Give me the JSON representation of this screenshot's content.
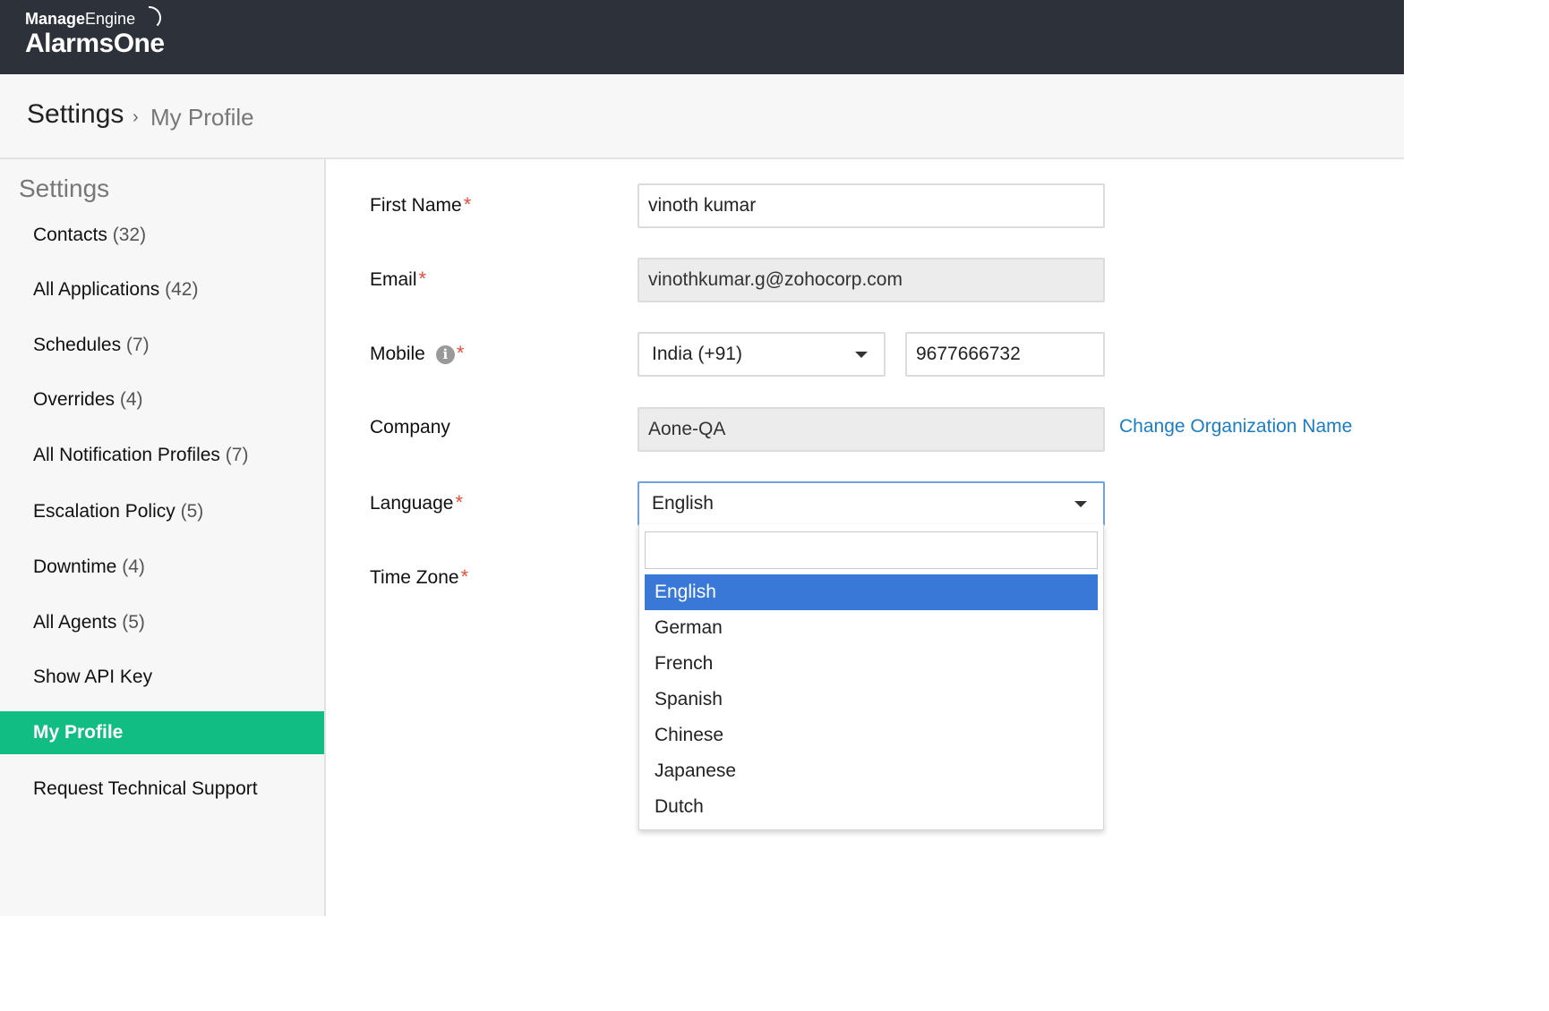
{
  "brand": {
    "company_bold": "Manage",
    "company_light": "Engine",
    "product": "AlarmsOne"
  },
  "breadcrumb": {
    "main": "Settings",
    "separator": "›",
    "current": "My Profile"
  },
  "sidebar": {
    "title": "Settings",
    "items": [
      {
        "label": "Contacts",
        "count": "(32)"
      },
      {
        "label": "All Applications",
        "count": "(42)"
      },
      {
        "label": "Schedules",
        "count": "(7)"
      },
      {
        "label": "Overrides",
        "count": "(4)"
      },
      {
        "label": "All Notification Profiles",
        "count": "(7)"
      },
      {
        "label": "Escalation Policy",
        "count": "(5)"
      },
      {
        "label": "Downtime",
        "count": "(4)"
      },
      {
        "label": "All Agents",
        "count": "(5)"
      },
      {
        "label": "Show API Key",
        "count": ""
      },
      {
        "label": "My Profile",
        "count": "",
        "active": true
      },
      {
        "label": "Request Technical Support",
        "count": ""
      }
    ]
  },
  "form": {
    "first_name_label": "First Name",
    "first_name_value": "vinoth kumar",
    "email_label": "Email",
    "email_value": "vinothkumar.g@zohocorp.com",
    "mobile_label": "Mobile",
    "mobile_country": "India (+91)",
    "mobile_number": "9677666732",
    "company_label": "Company",
    "company_value": "Aone-QA",
    "change_org_link": "Change Organization Name",
    "language_label": "Language",
    "language_value": "English",
    "timezone_label": "Time Zone",
    "required_mark": "*",
    "info_glyph": "i"
  },
  "language_dropdown": {
    "search_value": "",
    "options": [
      "English",
      "German",
      "French",
      "Spanish",
      "Chinese",
      "Japanese",
      "Dutch"
    ],
    "selected": "English"
  },
  "colors": {
    "topbar": "#2d3139",
    "active_nav": "#12bd84",
    "link": "#1a7ec6",
    "required": "#e74c3c",
    "option_highlight": "#3a78d7"
  }
}
